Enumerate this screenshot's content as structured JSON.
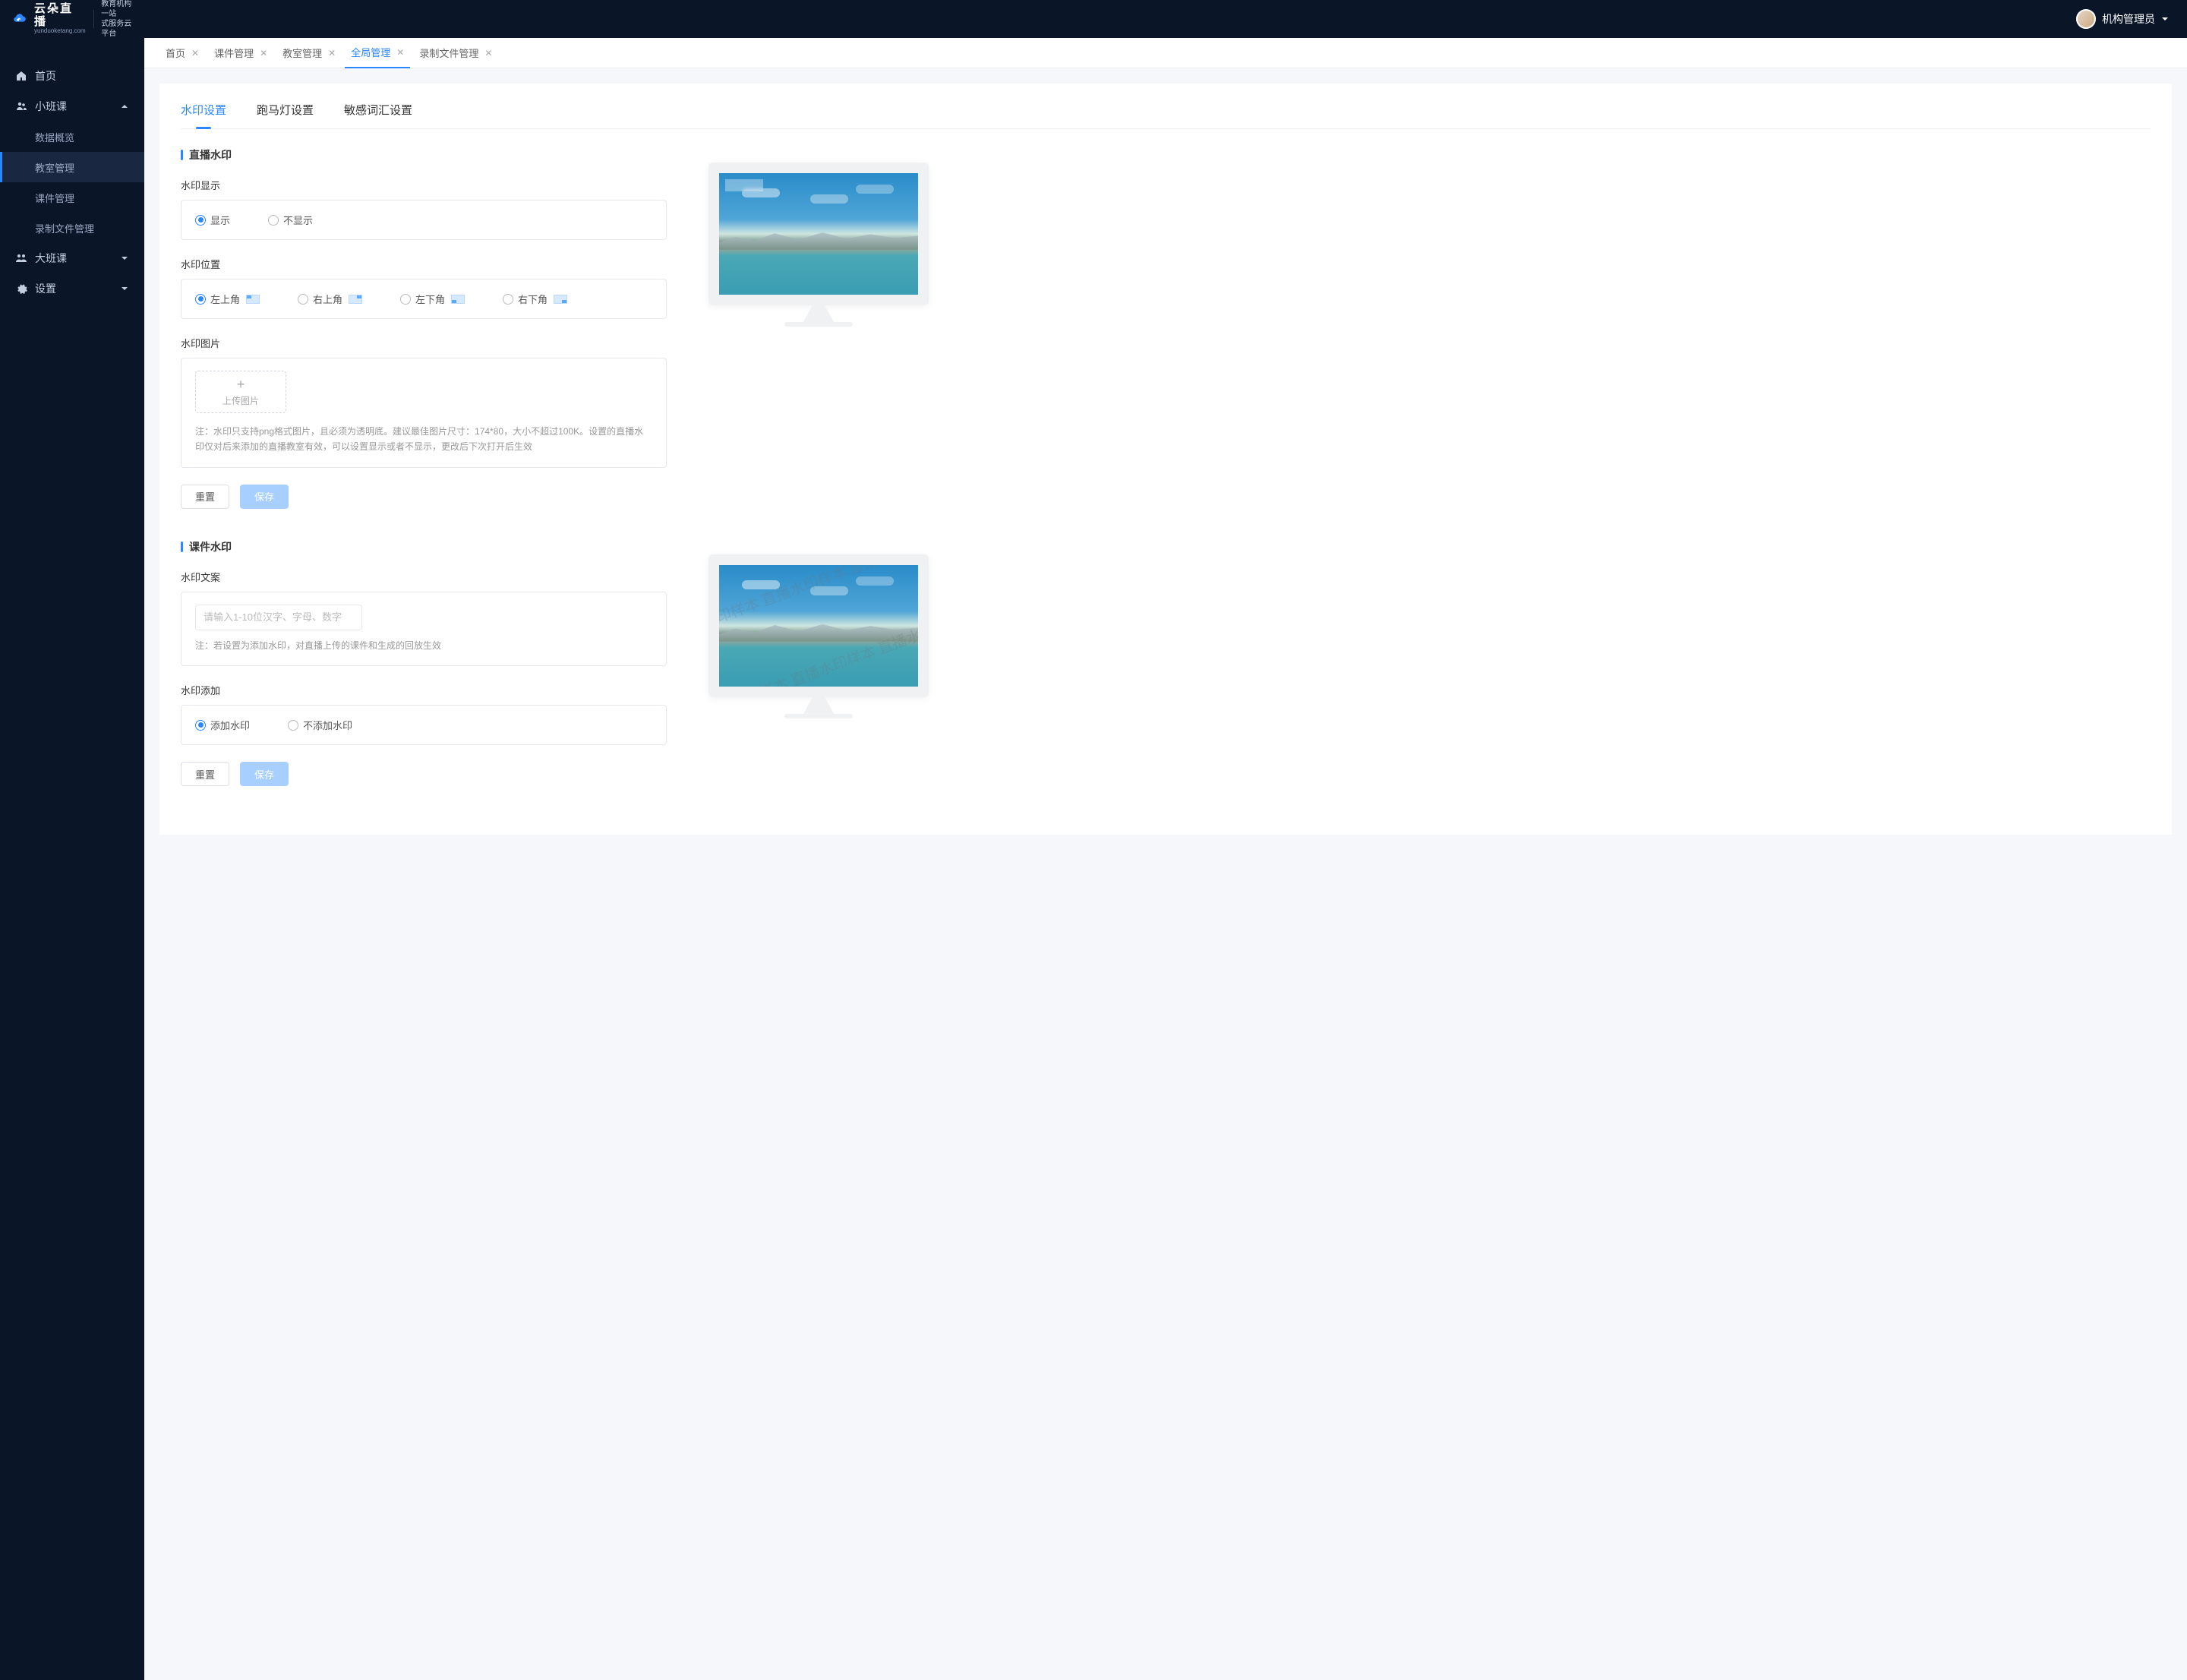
{
  "brand": {
    "name": "云朵直播",
    "domain": "yunduoketang.com",
    "tagline_line1": "教育机构一站",
    "tagline_line2": "式服务云平台"
  },
  "topbar": {
    "username": "机构管理员"
  },
  "nav": {
    "items": [
      {
        "key": "home",
        "label": "首页"
      },
      {
        "key": "small",
        "label": "小班课",
        "expandable": true,
        "expanded": true,
        "children": [
          {
            "key": "data",
            "label": "数据概览"
          },
          {
            "key": "classroom",
            "label": "教室管理",
            "active": true
          },
          {
            "key": "courseware",
            "label": "课件管理"
          },
          {
            "key": "recording",
            "label": "录制文件管理"
          }
        ]
      },
      {
        "key": "big",
        "label": "大班课",
        "expandable": true
      },
      {
        "key": "settings",
        "label": "设置",
        "expandable": true
      }
    ]
  },
  "tabs": [
    {
      "label": "首页",
      "closable": true
    },
    {
      "label": "课件管理",
      "closable": true
    },
    {
      "label": "教室管理",
      "closable": true
    },
    {
      "label": "全局管理",
      "closable": true,
      "active": true
    },
    {
      "label": "录制文件管理",
      "closable": true
    }
  ],
  "subTabs": [
    {
      "label": "水印设置",
      "active": true
    },
    {
      "label": "跑马灯设置"
    },
    {
      "label": "敏感词汇设置"
    }
  ],
  "sections": {
    "live": {
      "title": "直播水印",
      "display": {
        "label": "水印显示",
        "options": [
          "显示",
          "不显示"
        ],
        "value": "显示"
      },
      "position": {
        "label": "水印位置",
        "options": [
          "左上角",
          "右上角",
          "左下角",
          "右下角"
        ],
        "value": "左上角"
      },
      "image": {
        "label": "水印图片",
        "upload_label": "上传图片",
        "hint": "注：水印只支持png格式图片，且必须为透明底。建议最佳图片尺寸：174*80，大小不超过100K。设置的直播水印仅对后来添加的直播教室有效，可以设置显示或者不显示，更改后下次打开后生效"
      },
      "buttons": {
        "reset": "重置",
        "save": "保存"
      }
    },
    "courseware": {
      "title": "课件水印",
      "text": {
        "label": "水印文案",
        "placeholder": "请输入1-10位汉字、字母、数字",
        "hint": "注：若设置为添加水印，对直播上传的课件和生成的回放生效"
      },
      "add": {
        "label": "水印添加",
        "options": [
          "添加水印",
          "不添加水印"
        ],
        "value": "添加水印"
      },
      "buttons": {
        "reset": "重置",
        "save": "保存"
      },
      "preview_sample": "直播水印样本"
    }
  }
}
